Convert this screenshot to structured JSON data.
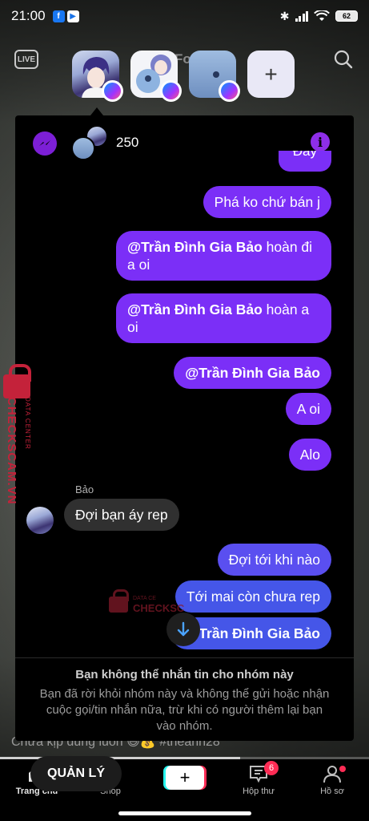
{
  "status_bar": {
    "time": "21:00",
    "battery": "62",
    "icons": [
      "facebook-icon",
      "play-store-icon",
      "bluetooth-icon",
      "signal-icon",
      "wifi-icon",
      "battery-icon"
    ]
  },
  "top_header": {
    "live_label": "LIVE",
    "tab_hint": "Fo"
  },
  "chat_heads": {
    "add_label": "+"
  },
  "chat": {
    "group_name": "250",
    "messages": [
      {
        "type": "outgoing",
        "mention": "",
        "text": "Đây"
      },
      {
        "type": "outgoing",
        "mention": "",
        "text": "Phá ko chứ bán j"
      },
      {
        "type": "outgoing",
        "mention": "@Trần Đình Gia Bảo",
        "text": "  hoàn đi a oi"
      },
      {
        "type": "outgoing",
        "mention": "@Trần Đình Gia Bảo",
        "text": " hoàn a oi"
      },
      {
        "type": "outgoing",
        "mention": "@Trần Đình Gia Bảo",
        "text": ""
      },
      {
        "type": "outgoing",
        "mention": "",
        "text": "A oi"
      },
      {
        "type": "outgoing",
        "mention": "",
        "text": "Alo"
      },
      {
        "type": "incoming",
        "sender": "Bảo",
        "text": "Đợi bạn áy rep"
      },
      {
        "type": "outgoing",
        "mention": "",
        "text": "Đợi tới khi nào"
      },
      {
        "type": "outgoing",
        "mention": "",
        "text": "Tới mai còn chưa rep"
      },
      {
        "type": "outgoing",
        "mention": "Trần Đình Gia Bảo",
        "text": ""
      }
    ],
    "notice_title": "Bạn không thể nhắn tin cho nhóm này",
    "notice_body": "Bạn đã rời khỏi nhóm này và không thể gửi hoặc nhận cuộc gọi/tin nhắn nữa, trừ khi có người thêm lại bạn vào nhóm."
  },
  "watermark": {
    "brand": "CHECKSCAM.VN",
    "sub": "DATA CENTER",
    "center_top": "DATA CE",
    "center_brand": "CHECKSC"
  },
  "behind": {
    "caption": "Chưa kịp đúng luôn 😅💰 #theanh28"
  },
  "video_progress": 0.65,
  "manage_button": "QUẢN LÝ",
  "bottom_nav": {
    "home": "Trang chủ",
    "shop": "Shop",
    "create": "+",
    "inbox": "Hộp thư",
    "inbox_badge": "6",
    "profile": "Hồ sơ"
  },
  "colors": {
    "outgoing_purple": "#7b2ff7",
    "outgoing_blue": "#4556e8",
    "incoming_gray": "#303030",
    "watermark_red": "#c4223a"
  }
}
